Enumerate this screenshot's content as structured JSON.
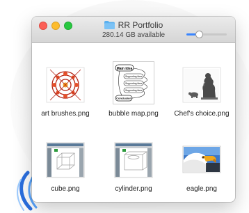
{
  "window": {
    "title": "RR Portfolio",
    "status": "280.14 GB available",
    "zoom_level": 0.28
  },
  "files": [
    {
      "name": "art brushes.png",
      "icon": "art-brushes-thumbnail"
    },
    {
      "name": "bubble map.png",
      "icon": "bubble-map-thumbnail"
    },
    {
      "name": "Chef's choice.png",
      "icon": "chefs-choice-thumbnail"
    },
    {
      "name": "cube.png",
      "icon": "cube-thumbnail"
    },
    {
      "name": "cylinder.png",
      "icon": "cylinder-thumbnail"
    },
    {
      "name": "eagle.png",
      "icon": "eagle-thumbnail"
    }
  ],
  "bubble_map": {
    "main": "Main Idea",
    "supporting": [
      "Supporting idea",
      "Supporting idea",
      "Supporting idea"
    ],
    "conclusion": "Conclusion"
  },
  "colors": {
    "close": "#fc5f57",
    "minimize": "#fdbc2e",
    "maximize": "#28c840",
    "folder": "#5ab0ef",
    "accent": "#3a86ff"
  }
}
